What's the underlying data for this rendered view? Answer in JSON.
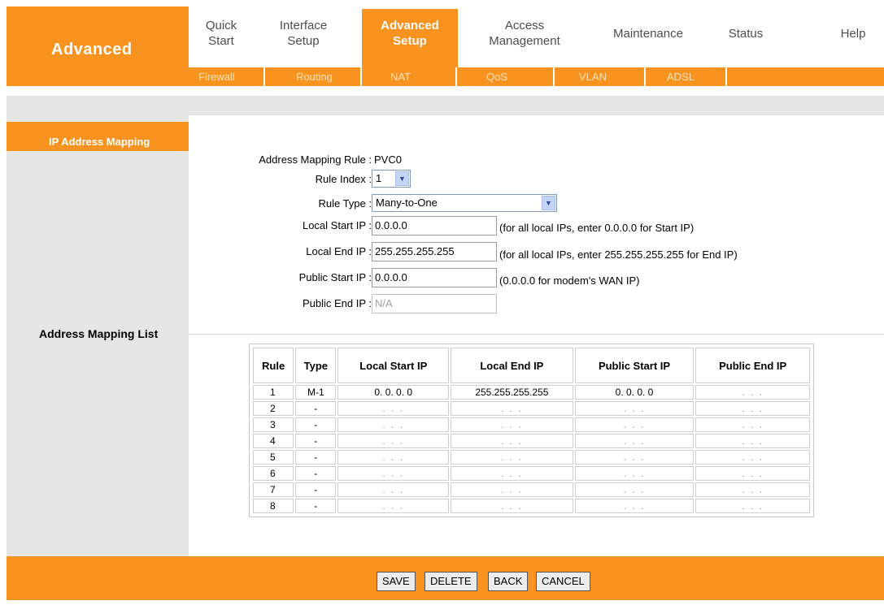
{
  "brand": {
    "title": "Advanced"
  },
  "main_nav": [
    {
      "line1": "Quick",
      "line2": "Start",
      "active": false
    },
    {
      "line1": "Interface",
      "line2": "Setup",
      "active": false
    },
    {
      "line1": "Advanced",
      "line2": "Setup",
      "active": true
    },
    {
      "line1": "Access",
      "line2": "Management",
      "active": false
    },
    {
      "line1": "Maintenance",
      "line2": "",
      "active": false
    },
    {
      "line1": "Status",
      "line2": "",
      "active": false
    },
    {
      "line1": "Help",
      "line2": "",
      "active": false
    }
  ],
  "sub_nav": [
    "Firewall",
    "Routing",
    "NAT",
    "QoS",
    "VLAN",
    "ADSL"
  ],
  "sidebar": {
    "section_title": "IP Address Mapping",
    "list_label": "Address Mapping List"
  },
  "form": {
    "mapping_rule_label": "Address Mapping Rule :",
    "mapping_rule_value": "PVC0",
    "rule_index_label": "Rule Index :",
    "rule_index_value": "1",
    "rule_type_label": "Rule Type :",
    "rule_type_value": "Many-to-One",
    "local_start_label": "Local Start IP :",
    "local_start_value": "0.0.0.0",
    "local_start_note": "(for all local IPs, enter 0.0.0.0 for Start IP)",
    "local_end_label": "Local End IP :",
    "local_end_value": "255.255.255.255",
    "local_end_note": "(for all local IPs, enter 255.255.255.255 for End IP)",
    "public_start_label": "Public Start IP :",
    "public_start_value": "0.0.0.0",
    "public_start_note": "(0.0.0.0 for modem's WAN IP)",
    "public_end_label": "Public End IP :",
    "public_end_value": "N/A"
  },
  "table": {
    "headers": [
      "Rule",
      "Type",
      "Local Start IP",
      "Local End IP",
      "Public Start IP",
      "Public End IP"
    ],
    "rows": [
      [
        "1",
        "M-1",
        "0. 0. 0. 0",
        "255.255.255.255",
        "0. 0. 0. 0",
        ". . ."
      ],
      [
        "2",
        "-",
        ". . .",
        ". . .",
        ". . .",
        ". . ."
      ],
      [
        "3",
        "-",
        ". . .",
        ". . .",
        ". . .",
        ". . ."
      ],
      [
        "4",
        "-",
        ". . .",
        ". . .",
        ". . .",
        ". . ."
      ],
      [
        "5",
        "-",
        ". . .",
        ". . .",
        ". . .",
        ". . ."
      ],
      [
        "6",
        "-",
        ". . .",
        ". . .",
        ". . .",
        ". . ."
      ],
      [
        "7",
        "-",
        ". . .",
        ". . .",
        ". . .",
        ". . ."
      ],
      [
        "8",
        "-",
        ". . .",
        ". . .",
        ". . .",
        ". . ."
      ]
    ]
  },
  "buttons": {
    "save": "SAVE",
    "delete": "DELETE",
    "back": "BACK",
    "cancel": "CANCEL"
  },
  "colors": {
    "accent": "#f7931e",
    "panel": "#e6e6e6",
    "subnav_text": "#ffe3bd"
  },
  "icons": {
    "dropdown": "chevron-down-icon"
  }
}
